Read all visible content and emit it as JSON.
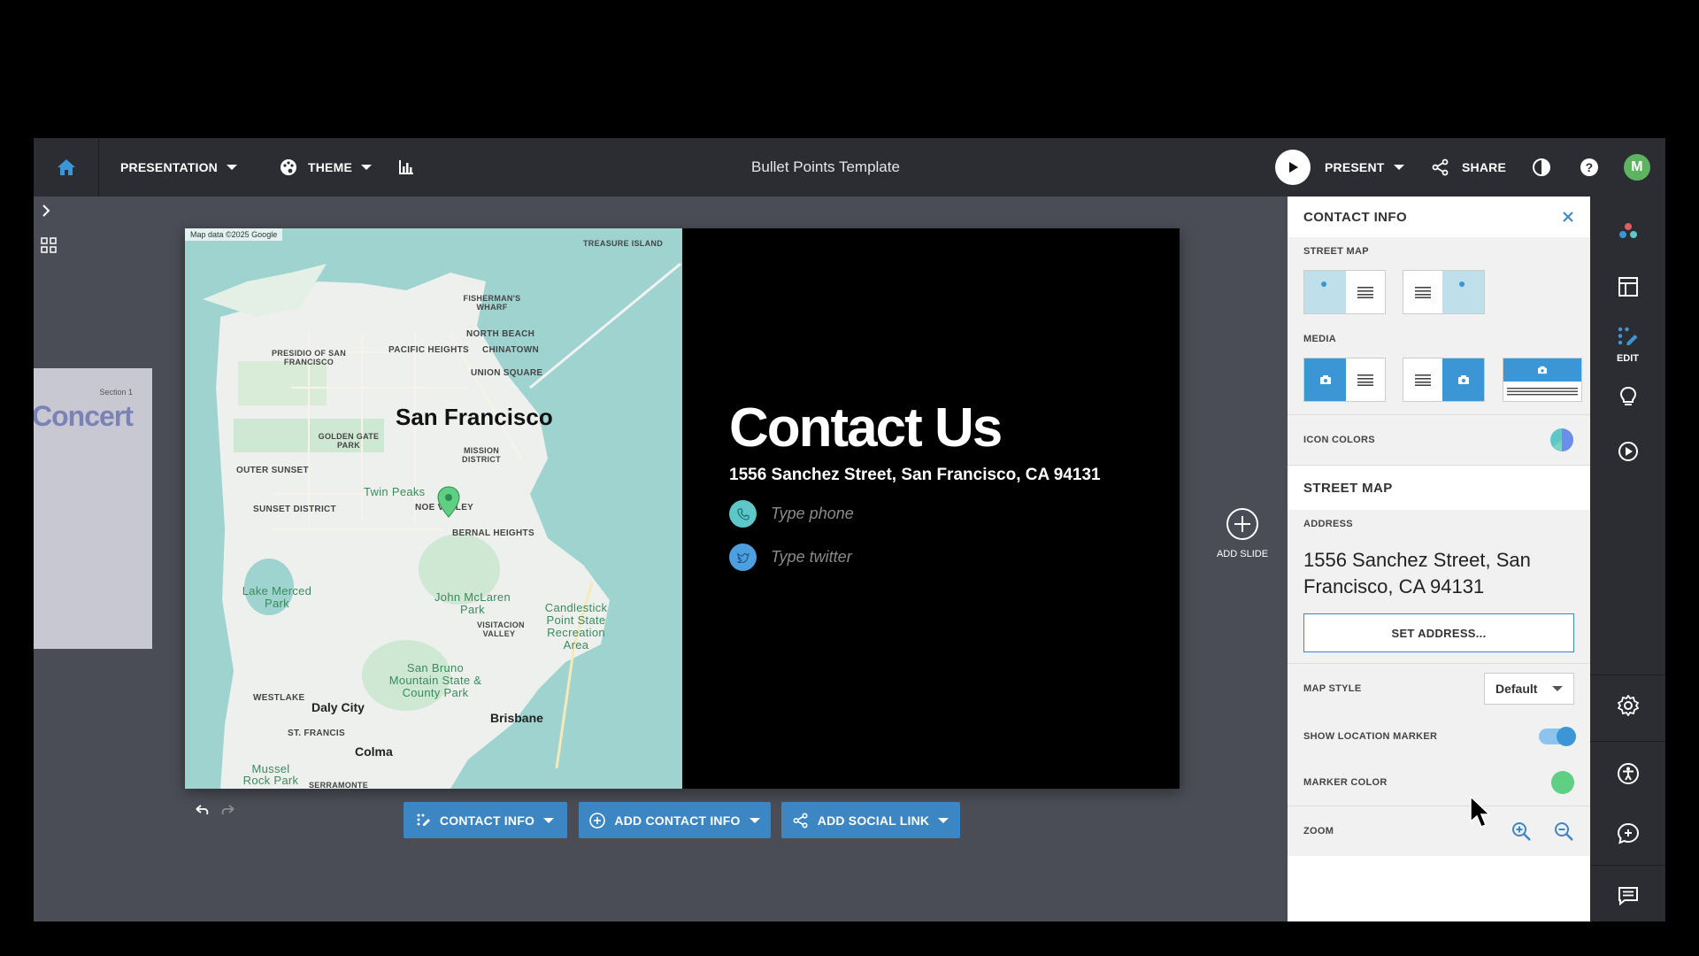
{
  "topbar": {
    "presentation_label": "PRESENTATION",
    "theme_label": "THEME",
    "doc_title": "Bullet Points Template",
    "present_label": "PRESENT",
    "share_label": "SHARE",
    "avatar_initial": "M"
  },
  "thumbnail": {
    "section": "Section 1",
    "title": "Concert"
  },
  "slide": {
    "map_credit": "Map data ©2025 Google",
    "map_labels": {
      "treasure_island": "TREASURE ISLAND",
      "fishermans_wharf": "FISHERMAN'S WHARF",
      "north_beach": "NORTH BEACH",
      "presidio": "PRESIDIO OF SAN FRANCISCO",
      "pacific_heights": "PACIFIC HEIGHTS",
      "chinatown": "CHINATOWN",
      "union_square": "UNION SQUARE",
      "san_francisco": "San Francisco",
      "golden_gate_park": "GOLDEN GATE PARK",
      "mission_district": "MISSION DISTRICT",
      "outer_sunset": "OUTER SUNSET",
      "twin_peaks": "Twin Peaks",
      "noe_valley": "NOE VALLEY",
      "sunset_district": "SUNSET DISTRICT",
      "bernal_heights": "BERNAL HEIGHTS",
      "lake_merced": "Lake Merced Park",
      "john_mclaren": "John McLaren Park",
      "visitacion": "VISITACION VALLEY",
      "candlestick": "Candlestick Point State Recreation Area",
      "san_bruno": "San Bruno Mountain State & County Park",
      "westlake": "WESTLAKE",
      "daly_city": "Daly City",
      "brisbane": "Brisbane",
      "st_francis": "ST. FRANCIS",
      "colma": "Colma",
      "mussel_rock": "Mussel Rock Park",
      "serramonte": "SERRAMONTE"
    },
    "title": "Contact Us",
    "address": "1556 Sanchez Street, San Francisco, CA 94131",
    "phone_placeholder": "Type phone",
    "twitter_placeholder": "Type twitter"
  },
  "add_slide_label": "ADD SLIDE",
  "bottom_toolbar": {
    "contact_info": "CONTACT INFO",
    "add_contact_info": "ADD CONTACT INFO",
    "add_social_link": "ADD SOCIAL LINK"
  },
  "panel": {
    "header": "CONTACT INFO",
    "street_map_label": "STREET MAP",
    "media_label": "MEDIA",
    "icon_colors_label": "ICON COLORS",
    "street_map_section": "STREET MAP",
    "address_label": "ADDRESS",
    "address_value": "1556 Sanchez Street, San Francisco, CA 94131",
    "set_address": "SET ADDRESS...",
    "map_style_label": "MAP STYLE",
    "map_style_value": "Default",
    "show_marker_label": "SHOW LOCATION MARKER",
    "show_marker_on": true,
    "marker_color_label": "MARKER COLOR",
    "marker_color": "#5fcf84",
    "zoom_label": "ZOOM"
  },
  "rail": {
    "edit_label": "EDIT"
  },
  "colors": {
    "accent": "#3c86c4",
    "phone_icon": "#5ec8c9",
    "twitter_icon": "#4d9fe0"
  },
  "icons": [
    "home-icon",
    "theme-palette-icon",
    "chart-icon",
    "play-icon",
    "share-icon",
    "contrast-icon",
    "help-icon",
    "chevron-right-icon",
    "grid-icon",
    "undo-icon",
    "redo-icon",
    "add-circle-icon",
    "close-icon",
    "zoom-in-icon",
    "zoom-out-icon",
    "gear-icon",
    "accessibility-icon",
    "comment-add-icon",
    "notes-icon",
    "layout-icon",
    "edit-dots-icon",
    "lightbulb-icon",
    "play-circle-icon",
    "colors-dots-icon"
  ]
}
